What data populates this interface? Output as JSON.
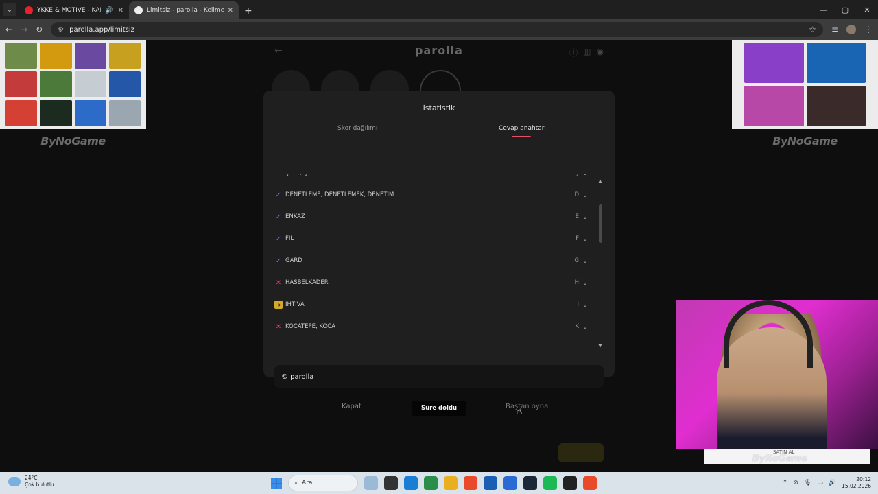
{
  "browser": {
    "tabs": [
      {
        "title": "YKKE & MOTIVE - KARANLI",
        "audio": "🔊",
        "close": "✕",
        "active": false,
        "favicon_color": "#e8222b"
      },
      {
        "title": "Limitsiz - parolla - Kelime oyun",
        "audio": "",
        "close": "✕",
        "active": true,
        "favicon_color": "#eeeeee"
      }
    ],
    "new_tab": "+",
    "url": "parolla.app/limitsiz",
    "window_controls": [
      "—",
      "▢",
      "✕"
    ]
  },
  "game": {
    "logo": "parolla",
    "back": "←",
    "header_icons": [
      "ⓘ",
      "▥",
      "◉"
    ]
  },
  "ads": {
    "brand": "ByNoGame",
    "left_tile_colors": [
      "#6e8b4a",
      "#d39a10",
      "#6a4aa0",
      "#c8a020",
      "#c33b3b",
      "#4b7a3a",
      "#c5ccd2",
      "#2457a8",
      "#d44034",
      "#1b2b20",
      "#2c6bc7",
      "#9aa6b0"
    ],
    "right_tile_colors": [
      "#8a3fc9",
      "#1a64b4",
      "#b848a8",
      "#3a2a2a"
    ]
  },
  "modal": {
    "title": "İstatistik",
    "tabs": [
      {
        "label": "Skor dağılımı",
        "active": false
      },
      {
        "label": "Cevap anahtarı",
        "active": true
      }
    ],
    "rows": [
      {
        "status": "ok",
        "mark": "✓",
        "word": "ÇIKTI, ÇIKTISI",
        "letter": "Ç"
      },
      {
        "status": "ok",
        "mark": "✓",
        "word": "DENETLEME, DENETLEMEK, DENETİM",
        "letter": "D"
      },
      {
        "status": "ok",
        "mark": "✓",
        "word": "ENKAZ",
        "letter": "E"
      },
      {
        "status": "ok",
        "mark": "✓",
        "word": "FİL",
        "letter": "F"
      },
      {
        "status": "ok",
        "mark": "✓",
        "word": "GARD",
        "letter": "G"
      },
      {
        "status": "bad",
        "mark": "✕",
        "word": "HASBELKADER",
        "letter": "H"
      },
      {
        "status": "skip",
        "mark": "➜",
        "word": "İHTİVA",
        "letter": "İ"
      },
      {
        "status": "bad",
        "mark": "✕",
        "word": "KOCATEPE, KOCA",
        "letter": "K"
      }
    ],
    "credit": "© parolla",
    "close_label": "Kapat",
    "time_up_label": "Süre doldu",
    "restart_label": "Baştan oyna"
  },
  "overlay": {
    "label_satin": "SATIN AL",
    "label_brand": "ByNoGame"
  },
  "taskbar": {
    "weather_temp": "24°C",
    "weather_desc": "Çok bulutlu",
    "search": "Ara",
    "time": "20:12",
    "date": "15.02.2026",
    "app_icon_colors": [
      "#9bbad8",
      "#333333",
      "#1a7fd4",
      "#2a8d4a",
      "#e8b020",
      "#e84a2a",
      "#1a5fb4",
      "#2a6ad4",
      "#1b2838",
      "#1db954",
      "#222222",
      "#e84a2a"
    ]
  }
}
